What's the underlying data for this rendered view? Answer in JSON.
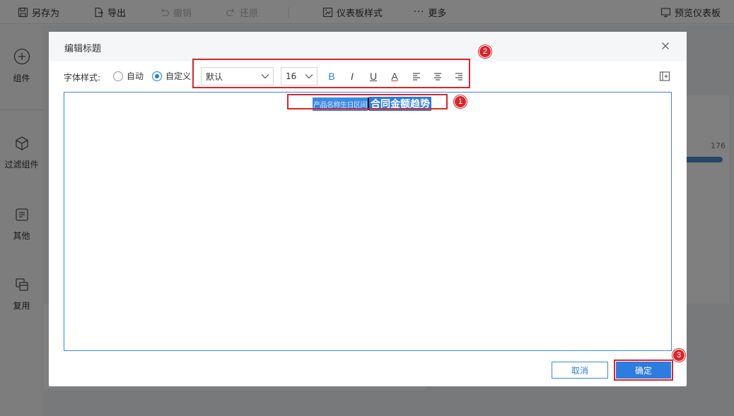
{
  "toolbar": {
    "save_as": "另存为",
    "export": "导出",
    "undo": "撤销",
    "redo": "还原",
    "dashboard_style": "仪表板样式",
    "more": "更多",
    "preview": "预览仪表板"
  },
  "left_rail": {
    "components": "组件",
    "filter_components": "过滤组件",
    "others": "其他",
    "reuse": "复用"
  },
  "background": {
    "value": "176"
  },
  "dialog": {
    "title": "编辑标题",
    "font_style_label": "字体样式:",
    "radio_auto": "自动",
    "radio_custom": "自定义",
    "radio_selected": "自定义",
    "font_family": "默认",
    "font_size": "16",
    "format_buttons": {
      "bold": "B",
      "italic": "I",
      "underline": "U",
      "font_color": "A"
    },
    "title_text": {
      "selected_small": "产品名称生日区间",
      "selected_main": "合同金额趋势"
    },
    "cancel": "取消",
    "confirm": "确定"
  },
  "annotations": {
    "badge_1": "1",
    "badge_2": "2",
    "badge_3": "3"
  },
  "colors": {
    "accent": "#2d7ce0",
    "highlight": "#d9262c",
    "overlay": "rgba(0,0,0,0.5)"
  }
}
